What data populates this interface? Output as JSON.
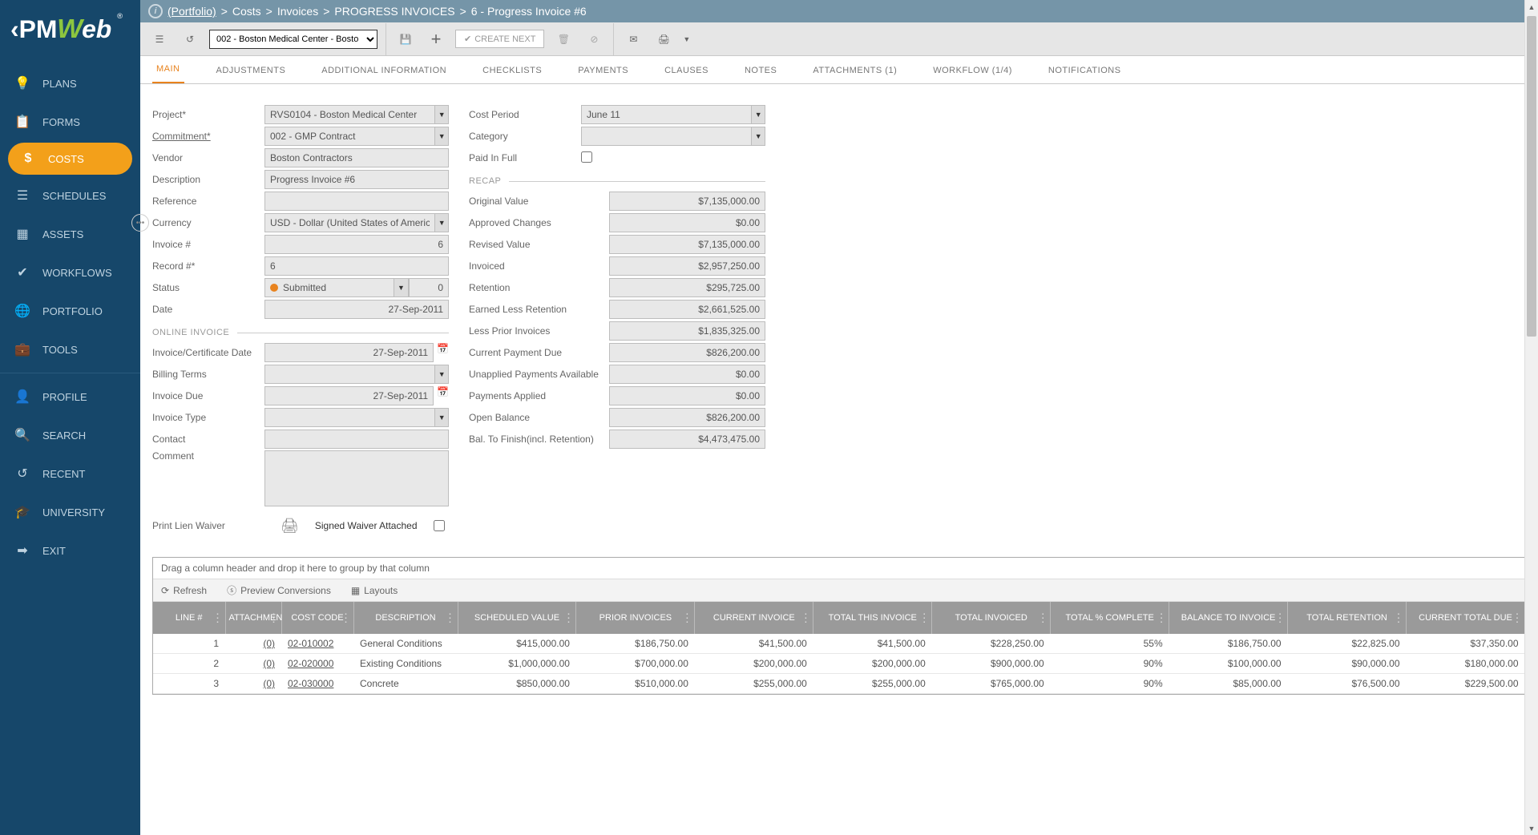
{
  "breadcrumb": {
    "portfolio": "(Portfolio)",
    "parts": [
      "Costs",
      "Invoices",
      "PROGRESS INVOICES",
      "6 - Progress Invoice #6"
    ]
  },
  "toolbar": {
    "context_select": "002 - Boston Medical Center - Bosto",
    "create_next": "CREATE NEXT"
  },
  "tabs": {
    "main": "MAIN",
    "adjustments": "ADJUSTMENTS",
    "additional": "ADDITIONAL INFORMATION",
    "checklists": "CHECKLISTS",
    "payments": "PAYMENTS",
    "clauses": "CLAUSES",
    "notes": "NOTES",
    "attachments": "ATTACHMENTS (1)",
    "workflow": "WORKFLOW (1/4)",
    "notifications": "NOTIFICATIONS"
  },
  "form": {
    "left": {
      "project_label": "Project*",
      "project_value": "RVS0104 - Boston Medical Center",
      "commitment_label": "Commitment*",
      "commitment_value": "002 - GMP Contract",
      "vendor_label": "Vendor",
      "vendor_value": "Boston Contractors",
      "description_label": "Description",
      "description_value": "Progress Invoice #6",
      "reference_label": "Reference",
      "reference_value": "",
      "currency_label": "Currency",
      "currency_value": "USD - Dollar (United States of America)",
      "invoice_num_label": "Invoice #",
      "invoice_num_value": "6",
      "record_num_label": "Record #*",
      "record_num_value": "6",
      "status_label": "Status",
      "status_value": "Submitted",
      "status_count": "0",
      "date_label": "Date",
      "date_value": "27-Sep-2011",
      "online_invoice_section": "ONLINE INVOICE",
      "inv_cert_date_label": "Invoice/Certificate Date",
      "inv_cert_date_value": "27-Sep-2011",
      "billing_terms_label": "Billing Terms",
      "billing_terms_value": "",
      "invoice_due_label": "Invoice Due",
      "invoice_due_value": "27-Sep-2011",
      "invoice_type_label": "Invoice Type",
      "invoice_type_value": "",
      "contact_label": "Contact",
      "contact_value": "",
      "comment_label": "Comment",
      "print_lien_label": "Print Lien Waiver",
      "signed_waiver_label": "Signed Waiver Attached"
    },
    "right": {
      "cost_period_label": "Cost Period",
      "cost_period_value": "June 11",
      "category_label": "Category",
      "category_value": "",
      "paid_in_full_label": "Paid In Full",
      "recap_section": "RECAP",
      "original_value_label": "Original Value",
      "original_value": "$7,135,000.00",
      "approved_changes_label": "Approved Changes",
      "approved_changes": "$0.00",
      "revised_value_label": "Revised Value",
      "revised_value": "$7,135,000.00",
      "invoiced_label": "Invoiced",
      "invoiced": "$2,957,250.00",
      "retention_label": "Retention",
      "retention": "$295,725.00",
      "earned_less_retention_label": "Earned Less Retention",
      "earned_less_retention": "$2,661,525.00",
      "less_prior_label": "Less Prior Invoices",
      "less_prior": "$1,835,325.00",
      "current_payment_label": "Current Payment Due",
      "current_payment": "$826,200.00",
      "unapplied_label": "Unapplied Payments Available",
      "unapplied": "$0.00",
      "payments_applied_label": "Payments Applied",
      "payments_applied": "$0.00",
      "open_balance_label": "Open Balance",
      "open_balance": "$826,200.00",
      "bal_to_finish_label": "Bal. To Finish(incl. Retention)",
      "bal_to_finish": "$4,473,475.00"
    }
  },
  "nav": {
    "plans": "PLANS",
    "forms": "FORMS",
    "costs": "COSTS",
    "schedules": "SCHEDULES",
    "assets": "ASSETS",
    "workflows": "WORKFLOWS",
    "portfolio": "PORTFOLIO",
    "tools": "TOOLS",
    "profile": "PROFILE",
    "search": "SEARCH",
    "recent": "RECENT",
    "university": "UNIVERSITY",
    "exit": "EXIT"
  },
  "grid": {
    "group_hint": "Drag a column header and drop it here to group by that column",
    "refresh": "Refresh",
    "preview": "Preview Conversions",
    "layouts": "Layouts",
    "headers": {
      "line": "LINE #",
      "attach": "ATTACHMEN",
      "cost_code": "COST CODE",
      "desc": "DESCRIPTION",
      "sched": "SCHEDULED VALUE",
      "prior": "PRIOR INVOICES",
      "current": "CURRENT INVOICE",
      "total_this": "TOTAL THIS INVOICE",
      "total_inv": "TOTAL INVOICED",
      "pct": "TOTAL % COMPLETE",
      "bal": "BALANCE TO INVOICE",
      "ret": "TOTAL RETENTION",
      "due": "CURRENT TOTAL DUE"
    },
    "rows": [
      {
        "line": "1",
        "att": "(0)",
        "code": "02-010002",
        "desc": "General Conditions",
        "sched": "$415,000.00",
        "prior": "$186,750.00",
        "cur": "$41,500.00",
        "this": "$41,500.00",
        "tinv": "$228,250.00",
        "pct": "55%",
        "bal": "$186,750.00",
        "ret": "$22,825.00",
        "due": "$37,350.00"
      },
      {
        "line": "2",
        "att": "(0)",
        "code": "02-020000",
        "desc": "Existing Conditions",
        "sched": "$1,000,000.00",
        "prior": "$700,000.00",
        "cur": "$200,000.00",
        "this": "$200,000.00",
        "tinv": "$900,000.00",
        "pct": "90%",
        "bal": "$100,000.00",
        "ret": "$90,000.00",
        "due": "$180,000.00"
      },
      {
        "line": "3",
        "att": "(0)",
        "code": "02-030000",
        "desc": "Concrete",
        "sched": "$850,000.00",
        "prior": "$510,000.00",
        "cur": "$255,000.00",
        "this": "$255,000.00",
        "tinv": "$765,000.00",
        "pct": "90%",
        "bal": "$85,000.00",
        "ret": "$76,500.00",
        "due": "$229,500.00"
      }
    ]
  }
}
